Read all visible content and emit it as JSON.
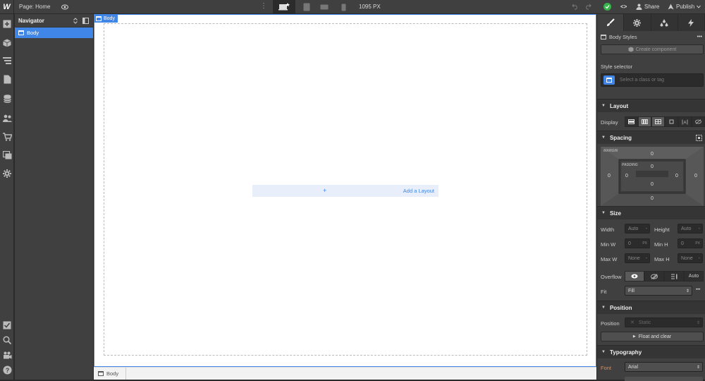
{
  "topbar": {
    "logo": "W",
    "page_label": "Page: Home",
    "width_readout": "1095 PX",
    "share_label": "Share",
    "publish_label": "Publish",
    "code_label": "<>"
  },
  "navigator": {
    "title": "Navigator",
    "selected_item": "Body"
  },
  "canvas": {
    "body_tag": "Body",
    "add_layout_plus": "+",
    "add_layout_label": "Add a Layout"
  },
  "breadcrumb": {
    "item": "Body"
  },
  "style_panel": {
    "body_styles": "Body Styles",
    "create_component": "Create component",
    "style_selector_label": "Style selector",
    "selector_placeholder": "Select a class or tag",
    "layout": {
      "title": "Layout",
      "display_label": "Display"
    },
    "spacing": {
      "title": "Spacing",
      "margin_label": "MARGIN",
      "padding_label": "PADDING",
      "margin_top": "0",
      "margin_left": "0",
      "margin_right": "0",
      "margin_bottom": "0",
      "padding_top": "0",
      "padding_left": "0",
      "padding_right": "0",
      "padding_bottom": "0"
    },
    "size": {
      "title": "Size",
      "width_label": "Width",
      "width_value": "Auto",
      "height_label": "Height",
      "height_value": "Auto",
      "minw_label": "Min W",
      "minw_value": "0",
      "minw_unit": "PX",
      "minh_label": "Min H",
      "minh_value": "0",
      "minh_unit": "PX",
      "maxw_label": "Max W",
      "maxw_value": "None",
      "maxh_label": "Max H",
      "maxh_value": "None",
      "overflow_label": "Overflow",
      "overflow_auto": "Auto",
      "fit_label": "Fit",
      "fit_value": "Fill",
      "more": "•••"
    },
    "position": {
      "title": "Position",
      "label": "Position",
      "value": "Static",
      "float_clear": "Float and clear"
    },
    "typography": {
      "title": "Typography",
      "font_label": "Font",
      "font_value": "Arial"
    }
  },
  "colors": {
    "accent": "#3f86e6",
    "success": "#38b44a",
    "font_label": "#e8894a"
  }
}
